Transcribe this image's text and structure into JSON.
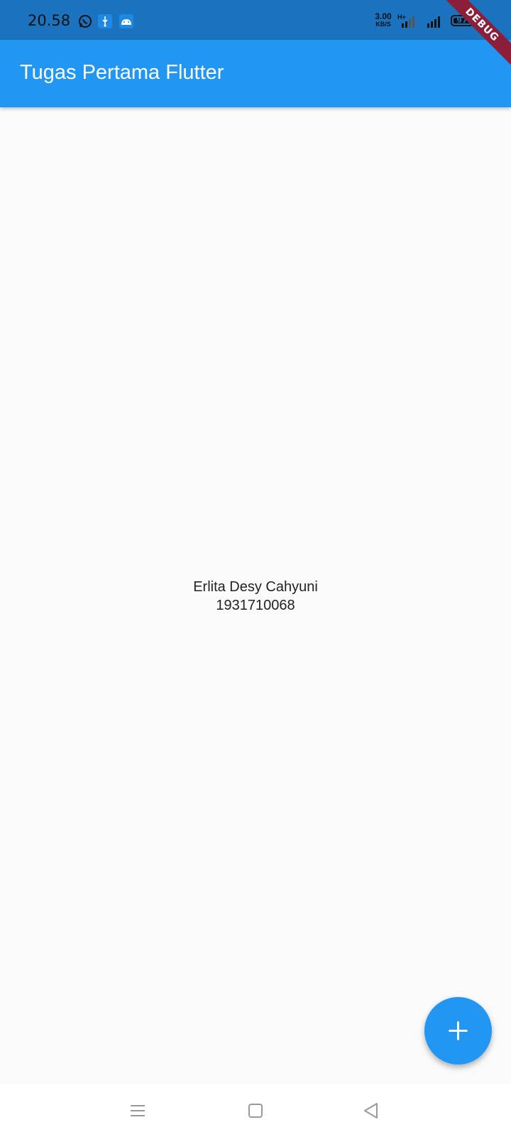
{
  "status_bar": {
    "time": "20.58",
    "net_speed_value": "3.00",
    "net_speed_unit": "KB/S",
    "network_type": "H+",
    "battery_level": "97",
    "icons": [
      "whatsapp-icon",
      "usb-icon",
      "android-icon",
      "signal-icon",
      "signal-icon",
      "battery-icon",
      "charging-icon"
    ]
  },
  "debug_banner": "DEBUG",
  "app_bar": {
    "title": "Tugas Pertama Flutter"
  },
  "body": {
    "name": "Erlita Desy Cahyuni",
    "student_id": "1931710068"
  },
  "fab": {
    "icon": "plus-icon"
  },
  "nav_bar": {
    "buttons": [
      "menu-icon",
      "home-icon",
      "back-icon"
    ]
  },
  "colors": {
    "status_bar": "#1b73bf",
    "primary": "#2196f3",
    "background": "#fafafa",
    "debug_ribbon": "#8b1f3a"
  }
}
